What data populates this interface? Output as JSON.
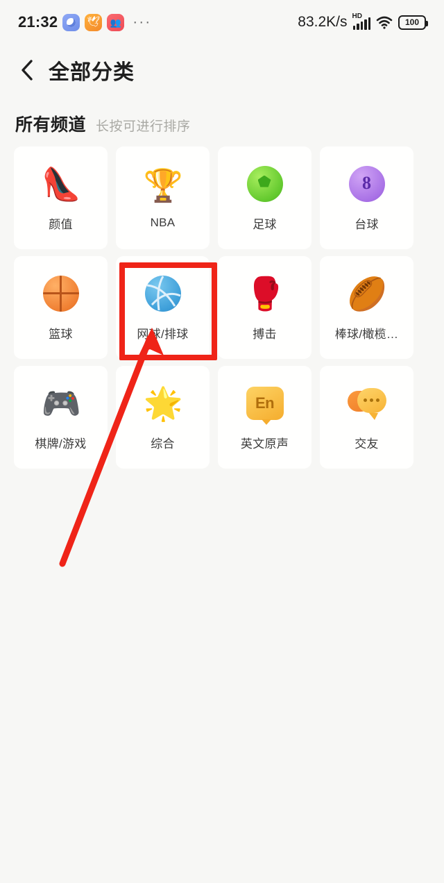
{
  "statusbar": {
    "time": "21:32",
    "overflow_dots": "···",
    "network_speed": "83.2K/s",
    "signal_type": "HD",
    "battery_level": "100",
    "notification_icons": [
      "messenger-app-icon",
      "bird-app-icon",
      "social-app-icon"
    ],
    "wifi_icon": "wifi-icon"
  },
  "navbar": {
    "back_icon": "chevron-left-icon",
    "title": "全部分类"
  },
  "section": {
    "title": "所有频道",
    "subtitle": "长按可进行排序"
  },
  "channels": [
    {
      "label": "颜值",
      "icon": "high-heel-shoe-icon"
    },
    {
      "label": "NBA",
      "icon": "trophy-icon"
    },
    {
      "label": "足球",
      "icon": "soccer-ball-icon"
    },
    {
      "label": "台球",
      "icon": "billiard-eight-ball-icon"
    },
    {
      "label": "篮球",
      "icon": "basketball-icon"
    },
    {
      "label": "网球/排球",
      "icon": "volleyball-icon"
    },
    {
      "label": "搏击",
      "icon": "boxing-glove-icon"
    },
    {
      "label": "棒球/橄榄…",
      "icon": "rugby-ball-icon"
    },
    {
      "label": "棋牌/游戏",
      "icon": "game-controller-icon"
    },
    {
      "label": "综合",
      "icon": "smiling-star-icon"
    },
    {
      "label": "英文原声",
      "icon": "english-badge-icon"
    },
    {
      "label": "交友",
      "icon": "speech-bubbles-icon"
    }
  ],
  "annotation": {
    "highlight_color": "#ef2418",
    "highlighted_channel": "网球/排球"
  },
  "colors": {
    "page_background": "#f7f7f5",
    "tile_background": "#fffffe",
    "title_text": "#1f1f1f",
    "label_text": "#3c3c3c",
    "subtitle_text": "#a9a9a4"
  }
}
